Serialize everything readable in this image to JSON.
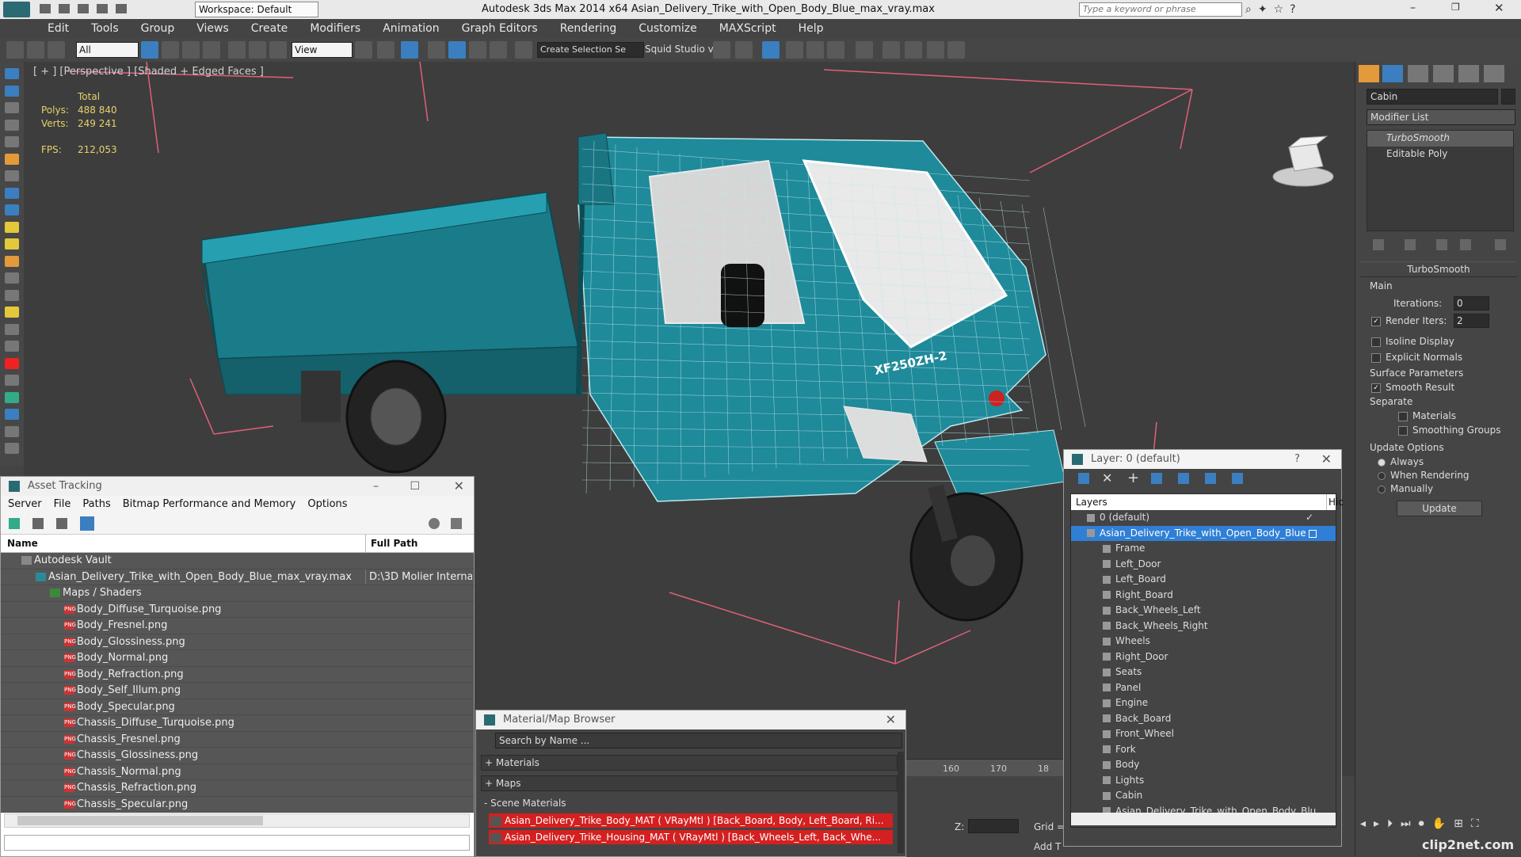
{
  "title_bar": {
    "workspace": "Workspace: Default",
    "app_title": "Autodesk 3ds Max  2014 x64     Asian_Delivery_Trike_with_Open_Body_Blue_max_vray.max",
    "search_placeholder": "Type a keyword or phrase"
  },
  "menu": [
    "Edit",
    "Tools",
    "Group",
    "Views",
    "Create",
    "Modifiers",
    "Animation",
    "Graph Editors",
    "Rendering",
    "Customize",
    "MAXScript",
    "Help"
  ],
  "toolbar": {
    "selection_filter": "All",
    "ref_coord": "View",
    "selection_set": "Create Selection Se",
    "squid_label": "Squid Studio v"
  },
  "viewport": {
    "label": "[ + ] [Perspective ] [Shaded + Edged Faces ]",
    "stats": {
      "total_label": "Total",
      "polys_label": "Polys:",
      "polys": "488 840",
      "verts_label": "Verts:",
      "verts": "249 241",
      "fps_label": "FPS:",
      "fps": "212,053"
    },
    "plate_text": "XF250ZH-2",
    "timeline_ticks": [
      "160",
      "170",
      "18"
    ],
    "z_label": "Z:",
    "grid_label": "Grid =",
    "add_label": "Add T"
  },
  "command_panel": {
    "object_name": "Cabin",
    "modifier_list": "Modifier List",
    "stack": [
      "TurboSmooth",
      "Editable Poly"
    ],
    "turbosmooth": {
      "header": "TurboSmooth",
      "main": "Main",
      "iterations_label": "Iterations:",
      "iterations": "0",
      "render_iters_label": "Render Iters:",
      "render_iters": "2",
      "isoline": "Isoline Display",
      "explicit_normals": "Explicit Normals",
      "surface_params": "Surface Parameters",
      "smooth_result": "Smooth Result",
      "separate": "Separate",
      "materials": "Materials",
      "smoothing_groups": "Smoothing Groups",
      "update_options": "Update Options",
      "always": "Always",
      "when_rendering": "When Rendering",
      "manually": "Manually",
      "update_button": "Update"
    }
  },
  "asset_tracking": {
    "title": "Asset Tracking",
    "menu": [
      "Server",
      "File",
      "Paths",
      "Bitmap Performance and Memory",
      "Options"
    ],
    "col_name": "Name",
    "col_path": "Full Path",
    "rows": [
      {
        "name": "Autodesk Vault",
        "path": "",
        "indent": 1,
        "type": "vault"
      },
      {
        "name": "Asian_Delivery_Trike_with_Open_Body_Blue_max_vray.max",
        "path": "D:\\3D Molier Interna",
        "indent": 2,
        "type": "max"
      },
      {
        "name": "Maps / Shaders",
        "path": "",
        "indent": 3,
        "type": "folder"
      },
      {
        "name": "Body_Diffuse_Turquoise.png",
        "path": "",
        "indent": 4,
        "type": "png"
      },
      {
        "name": "Body_Fresnel.png",
        "path": "",
        "indent": 4,
        "type": "png"
      },
      {
        "name": "Body_Glossiness.png",
        "path": "",
        "indent": 4,
        "type": "png"
      },
      {
        "name": "Body_Normal.png",
        "path": "",
        "indent": 4,
        "type": "png"
      },
      {
        "name": "Body_Refraction.png",
        "path": "",
        "indent": 4,
        "type": "png"
      },
      {
        "name": "Body_Self_Illum.png",
        "path": "",
        "indent": 4,
        "type": "png"
      },
      {
        "name": "Body_Specular.png",
        "path": "",
        "indent": 4,
        "type": "png"
      },
      {
        "name": "Chassis_Diffuse_Turquoise.png",
        "path": "",
        "indent": 4,
        "type": "png"
      },
      {
        "name": "Chassis_Fresnel.png",
        "path": "",
        "indent": 4,
        "type": "png"
      },
      {
        "name": "Chassis_Glossiness.png",
        "path": "",
        "indent": 4,
        "type": "png"
      },
      {
        "name": "Chassis_Normal.png",
        "path": "",
        "indent": 4,
        "type": "png"
      },
      {
        "name": "Chassis_Refraction.png",
        "path": "",
        "indent": 4,
        "type": "png"
      },
      {
        "name": "Chassis_Specular.png",
        "path": "",
        "indent": 4,
        "type": "png"
      }
    ]
  },
  "material_browser": {
    "title": "Material/Map Browser",
    "search_placeholder": "Search by Name ...",
    "sections": [
      "+ Materials",
      "+ Maps",
      "- Scene Materials"
    ],
    "items": [
      "Asian_Delivery_Trike_Body_MAT ( VRayMtl ) [Back_Board, Body, Left_Board, Ri...",
      "Asian_Delivery_Trike_Housing_MAT ( VRayMtl ) [Back_Wheels_Left, Back_Whe..."
    ]
  },
  "layer_window": {
    "title": "Layer: 0 (default)",
    "question": "?",
    "col_layers": "Layers",
    "col_hide": "Hic",
    "layers": [
      {
        "name": "0 (default)",
        "level": 0,
        "selected": false
      },
      {
        "name": "Asian_Delivery_Trike_with_Open_Body_Blue",
        "level": 0,
        "selected": true
      },
      {
        "name": "Frame",
        "level": 1,
        "selected": false
      },
      {
        "name": "Left_Door",
        "level": 1,
        "selected": false
      },
      {
        "name": "Left_Board",
        "level": 1,
        "selected": false
      },
      {
        "name": "Right_Board",
        "level": 1,
        "selected": false
      },
      {
        "name": "Back_Wheels_Left",
        "level": 1,
        "selected": false
      },
      {
        "name": "Back_Wheels_Right",
        "level": 1,
        "selected": false
      },
      {
        "name": "Wheels",
        "level": 1,
        "selected": false
      },
      {
        "name": "Right_Door",
        "level": 1,
        "selected": false
      },
      {
        "name": "Seats",
        "level": 1,
        "selected": false
      },
      {
        "name": "Panel",
        "level": 1,
        "selected": false
      },
      {
        "name": "Engine",
        "level": 1,
        "selected": false
      },
      {
        "name": "Back_Board",
        "level": 1,
        "selected": false
      },
      {
        "name": "Front_Wheel",
        "level": 1,
        "selected": false
      },
      {
        "name": "Fork",
        "level": 1,
        "selected": false
      },
      {
        "name": "Body",
        "level": 1,
        "selected": false
      },
      {
        "name": "Lights",
        "level": 1,
        "selected": false
      },
      {
        "name": "Cabin",
        "level": 1,
        "selected": false
      },
      {
        "name": "Asian_Delivery_Trike_with_Open_Body_Blu",
        "level": 1,
        "selected": false
      }
    ]
  },
  "watermark": "clip2net.com",
  "colors": {
    "trike_body": "#1f8a99",
    "bbox_lines": "#e0607a",
    "selection": "#2f7fd6",
    "stats": "#e3d36a"
  }
}
